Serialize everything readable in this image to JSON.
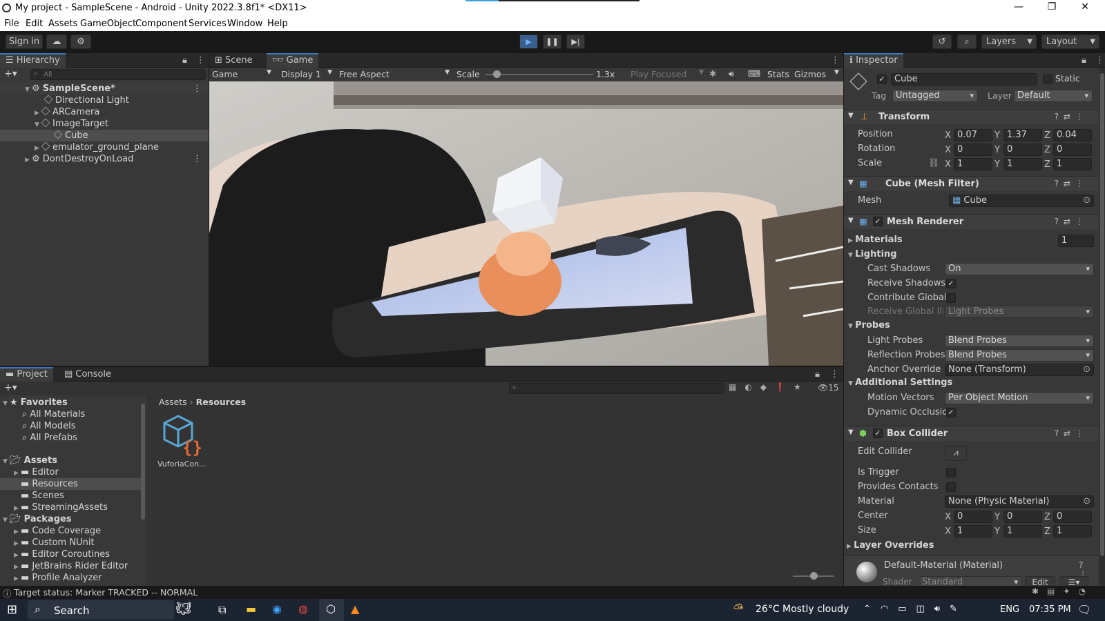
{
  "window": {
    "title": "My project - SampleScene - Android - Unity 2022.3.8f1* <DX11>"
  },
  "menu": [
    "File",
    "Edit",
    "Assets",
    "GameObject",
    "Component",
    "Services",
    "Window",
    "Help"
  ],
  "toolbar": {
    "sign_in": "Sign in",
    "layers": "Layers",
    "layout": "Layout"
  },
  "hierarchy": {
    "tab": "Hierarchy",
    "search_placeholder": "All",
    "items": [
      {
        "label": "SampleScene*"
      },
      {
        "label": "Directional Light"
      },
      {
        "label": "ARCamera"
      },
      {
        "label": "ImageTarget"
      },
      {
        "label": "Cube"
      },
      {
        "label": "emulator_ground_plane"
      },
      {
        "label": "DontDestroyOnLoad"
      }
    ]
  },
  "game": {
    "tabs": [
      "Scene",
      "Game"
    ],
    "mode": "Game",
    "display": "Display 1",
    "aspect": "Free Aspect",
    "scale_label": "Scale",
    "scale_value": "1.3x",
    "scale_fraction": 0.1,
    "play_focused": "Play Focused",
    "stats": "Stats",
    "gizmos": "Gizmos"
  },
  "project": {
    "tabs": [
      "Project",
      "Console"
    ],
    "hidden_count": "15",
    "favorites_label": "Favorites",
    "favorites": [
      "All Materials",
      "All Models",
      "All Prefabs"
    ],
    "assets_label": "Assets",
    "assets": [
      "Editor",
      "Resources",
      "Scenes",
      "StreamingAssets"
    ],
    "packages_label": "Packages",
    "packages": [
      "Code Coverage",
      "Custom NUnit",
      "Editor Coroutines",
      "JetBrains Rider Editor",
      "Profile Analyzer"
    ],
    "breadcrumb": [
      "Assets",
      "Resources"
    ],
    "file_name": "VuforiaCon...",
    "zoom_fraction": 0.5
  },
  "inspector": {
    "tab": "Inspector",
    "object_name": "Cube",
    "static_label": "Static",
    "tag_label": "Tag",
    "tag_value": "Untagged",
    "layer_label": "Layer",
    "layer_value": "Default",
    "transform": {
      "name": "Transform",
      "position_label": "Position",
      "position": [
        "0.07",
        "1.37",
        "0.04"
      ],
      "rotation_label": "Rotation",
      "rotation": [
        "0",
        "0",
        "0"
      ],
      "scale_label": "Scale",
      "scale": [
        "1",
        "1",
        "1"
      ]
    },
    "mesh_filter": {
      "name": "Cube (Mesh Filter)",
      "mesh_label": "Mesh",
      "mesh_value": "Cube"
    },
    "mesh_renderer": {
      "name": "Mesh Renderer",
      "materials_label": "Materials",
      "materials_count": "1",
      "lighting_label": "Lighting",
      "cast_shadows_label": "Cast Shadows",
      "cast_shadows": "On",
      "receive_shadows_label": "Receive Shadows",
      "contribute_gi_label": "Contribute Global",
      "receive_gi_label": "Receive Global Illu",
      "receive_gi_value": "Light Probes",
      "probes_label": "Probes",
      "light_probes_label": "Light Probes",
      "light_probes": "Blend Probes",
      "reflection_probes_label": "Reflection Probes",
      "reflection_probes": "Blend Probes",
      "anchor_label": "Anchor Override",
      "anchor_value": "None (Transform)",
      "additional_label": "Additional Settings",
      "motion_vectors_label": "Motion Vectors",
      "motion_vectors": "Per Object Motion",
      "dynamic_occlusion_label": "Dynamic Occlusio"
    },
    "box_collider": {
      "name": "Box Collider",
      "edit_collider_label": "Edit Collider",
      "is_trigger_label": "Is Trigger",
      "provides_contacts_label": "Provides Contacts",
      "material_label": "Material",
      "material_value": "None (Physic Material)",
      "center_label": "Center",
      "center": [
        "0",
        "0",
        "0"
      ],
      "size_label": "Size",
      "size": [
        "1",
        "1",
        "1"
      ]
    },
    "layer_overrides_label": "Layer Overrides",
    "material": {
      "name": "Default-Material (Material)",
      "shader_label": "Shader",
      "shader_value": "Standard",
      "edit_label": "Edit"
    }
  },
  "status_bar": "Target status: Marker TRACKED -- NORMAL",
  "taskbar": {
    "search": "Search",
    "weather": "26°C  Mostly cloudy",
    "lang": "ENG",
    "time": "07:35 PM"
  }
}
